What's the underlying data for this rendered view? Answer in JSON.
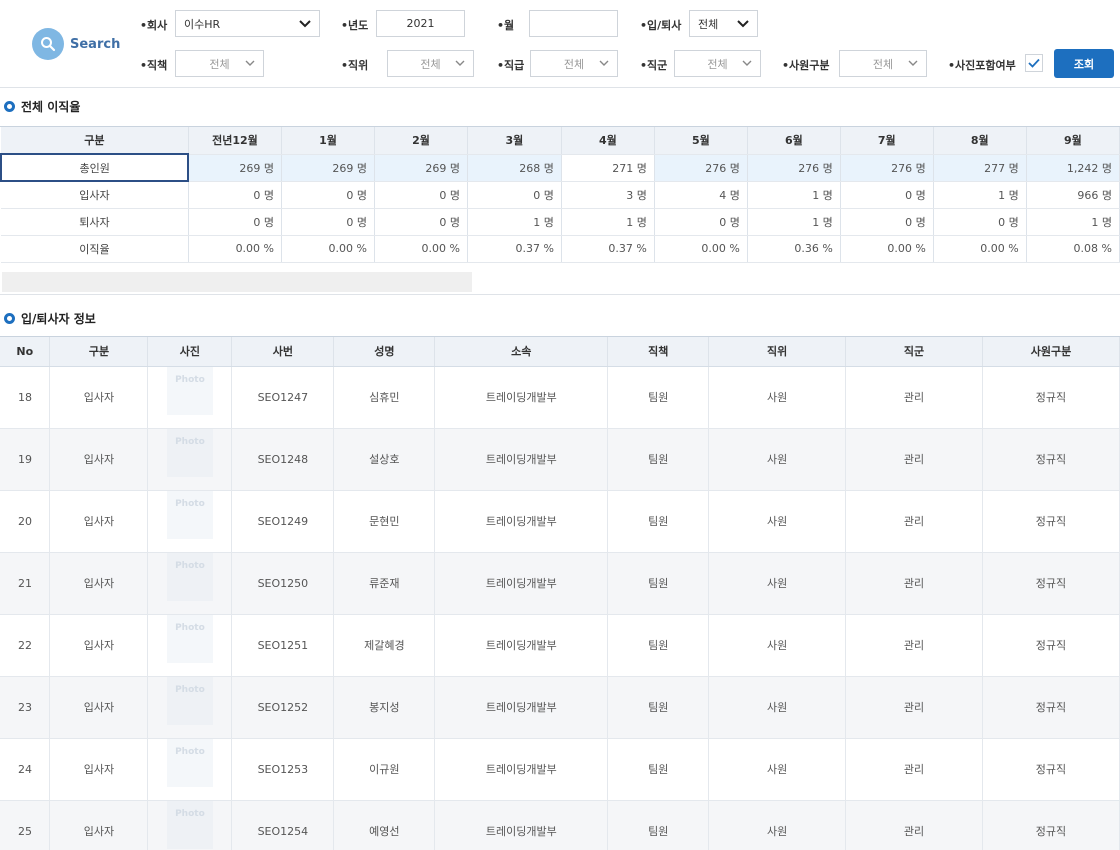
{
  "search": {
    "title": "Search",
    "company_label": "•회사",
    "company_value": "이수HR",
    "year_label": "•년도",
    "year_value": "2021",
    "month_label": "•월",
    "month_value": "",
    "inout_label": "•입/퇴사",
    "inout_value": "전체",
    "duty_label": "•직책",
    "duty_value": "전체",
    "position_label": "•직위",
    "position_value": "전체",
    "grade_label": "•직급",
    "grade_value": "전체",
    "jobgroup_label": "•직군",
    "jobgroup_value": "전체",
    "emptype_label": "•사원구분",
    "emptype_value": "전체",
    "photo_label": "•사진포함여부",
    "photo_checked": true,
    "search_button": "조회"
  },
  "rate_section": {
    "title": "전체 이직율",
    "headers": [
      "구분",
      "전년12월",
      "1월",
      "2월",
      "3월",
      "4월",
      "5월",
      "6월",
      "7월",
      "8월",
      "9월"
    ],
    "rows": [
      {
        "label": "총인원",
        "values": [
          "269 명",
          "269 명",
          "269 명",
          "268 명",
          "271 명",
          "276 명",
          "276 명",
          "276 명",
          "277 명",
          "1,242 명"
        ]
      },
      {
        "label": "입사자",
        "values": [
          "0 명",
          "0 명",
          "0 명",
          "0 명",
          "3 명",
          "4 명",
          "1 명",
          "0 명",
          "1 명",
          "966 명"
        ]
      },
      {
        "label": "퇴사자",
        "values": [
          "0 명",
          "0 명",
          "0 명",
          "1 명",
          "1 명",
          "0 명",
          "1 명",
          "0 명",
          "0 명",
          "1 명"
        ]
      },
      {
        "label": "이직율",
        "values": [
          "0.00 %",
          "0.00 %",
          "0.00 %",
          "0.37 %",
          "0.37 %",
          "0.00 %",
          "0.36 %",
          "0.00 %",
          "0.00 %",
          "0.08 %"
        ]
      }
    ]
  },
  "member_section": {
    "title": "입/퇴사자 정보",
    "headers": [
      "No",
      "구분",
      "사진",
      "사번",
      "성명",
      "소속",
      "직책",
      "직위",
      "직군",
      "사원구분"
    ],
    "photo_placeholder": "Photo",
    "rows": [
      {
        "no": "18",
        "type": "입사자",
        "emp_no": "SEO1247",
        "name": "심휴민",
        "dept": "트레이딩개발부",
        "duty": "팀원",
        "position": "사원",
        "group": "관리",
        "emp_type": "정규직"
      },
      {
        "no": "19",
        "type": "입사자",
        "emp_no": "SEO1248",
        "name": "설상호",
        "dept": "트레이딩개발부",
        "duty": "팀원",
        "position": "사원",
        "group": "관리",
        "emp_type": "정규직"
      },
      {
        "no": "20",
        "type": "입사자",
        "emp_no": "SEO1249",
        "name": "문현민",
        "dept": "트레이딩개발부",
        "duty": "팀원",
        "position": "사원",
        "group": "관리",
        "emp_type": "정규직"
      },
      {
        "no": "21",
        "type": "입사자",
        "emp_no": "SEO1250",
        "name": "류준재",
        "dept": "트레이딩개발부",
        "duty": "팀원",
        "position": "사원",
        "group": "관리",
        "emp_type": "정규직"
      },
      {
        "no": "22",
        "type": "입사자",
        "emp_no": "SEO1251",
        "name": "제갈혜경",
        "dept": "트레이딩개발부",
        "duty": "팀원",
        "position": "사원",
        "group": "관리",
        "emp_type": "정규직"
      },
      {
        "no": "23",
        "type": "입사자",
        "emp_no": "SEO1252",
        "name": "봉지성",
        "dept": "트레이딩개발부",
        "duty": "팀원",
        "position": "사원",
        "group": "관리",
        "emp_type": "정규직"
      },
      {
        "no": "24",
        "type": "입사자",
        "emp_no": "SEO1253",
        "name": "이규원",
        "dept": "트레이딩개발부",
        "duty": "팀원",
        "position": "사원",
        "group": "관리",
        "emp_type": "정규직"
      },
      {
        "no": "25",
        "type": "입사자",
        "emp_no": "SEO1254",
        "name": "예영선",
        "dept": "트레이딩개발부",
        "duty": "팀원",
        "position": "사원",
        "group": "관리",
        "emp_type": "정규직"
      }
    ]
  },
  "colors": {
    "accent": "#1d6fbf",
    "header_bg": "#eef2f7",
    "highlight_row": "#e9f3fc"
  }
}
